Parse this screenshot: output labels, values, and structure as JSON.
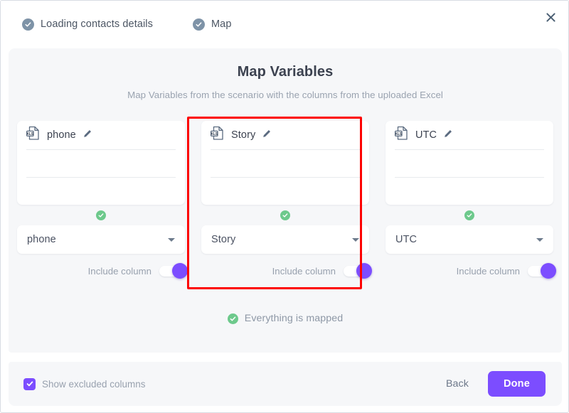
{
  "window": {
    "close_icon": "close-icon"
  },
  "steps": [
    {
      "label": "Loading contacts details",
      "icon": "check-circle-icon",
      "state": "complete"
    },
    {
      "label": "Map",
      "icon": "check-circle-icon",
      "state": "complete"
    }
  ],
  "panel": {
    "title": "Map Variables",
    "subtitle": "Map Variables from the scenario with the columns from the uploaded Excel"
  },
  "columns": [
    {
      "file_icon": "xls-file-icon",
      "name": "phone",
      "edit_icon": "pencil-icon",
      "preview_rows": [
        "",
        ""
      ],
      "mapped_icon": "check-circle-green-icon",
      "select_value": "phone",
      "caret_icon": "chevron-down-icon",
      "toggle_label": "Include column",
      "toggle_on": true
    },
    {
      "file_icon": "xls-file-icon",
      "name": "Story",
      "edit_icon": "pencil-icon",
      "preview_rows": [
        "",
        ""
      ],
      "mapped_icon": "check-circle-green-icon",
      "select_value": "Story",
      "caret_icon": "chevron-down-icon",
      "toggle_label": "Include column",
      "toggle_on": true
    },
    {
      "file_icon": "xls-file-icon",
      "name": "UTC",
      "edit_icon": "pencil-icon",
      "preview_rows": [
        "",
        ""
      ],
      "mapped_icon": "check-circle-green-icon",
      "select_value": "UTC",
      "caret_icon": "chevron-down-icon",
      "toggle_label": "Include column",
      "toggle_on": true
    }
  ],
  "status": {
    "icon": "check-circle-green-icon",
    "text": "Everything is mapped"
  },
  "footer": {
    "checkbox_label": "Show excluded columns",
    "checkbox_checked": true,
    "back_label": "Back",
    "done_label": "Done"
  },
  "colors": {
    "accent_purple": "#7c4dff",
    "success_green": "#6dc98c",
    "step_gray": "#7e93a7",
    "panel_bg": "#f6f7f9",
    "highlight_red": "#fd0000"
  }
}
